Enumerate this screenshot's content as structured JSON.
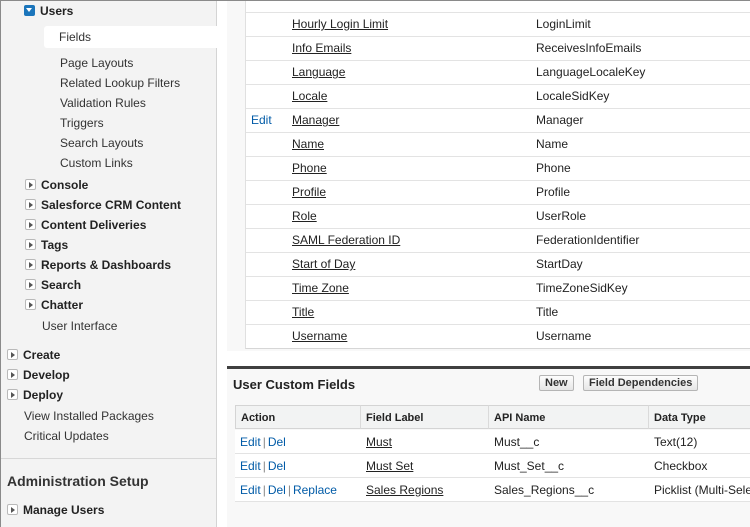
{
  "sidebar": {
    "users": "Users",
    "users_children": [
      "Fields",
      "Page Layouts",
      "Related Lookup Filters",
      "Validation Rules",
      "Triggers",
      "Search Layouts",
      "Custom Links"
    ],
    "customize_items": [
      "Console",
      "Salesforce CRM Content",
      "Content Deliveries",
      "Tags",
      "Reports & Dashboards",
      "Search",
      "Chatter"
    ],
    "user_interface": "User Interface",
    "top_items": [
      "Create",
      "Develop",
      "Deploy"
    ],
    "view_installed": "View Installed Packages",
    "critical_updates": "Critical Updates",
    "admin_setup": "Administration Setup",
    "manage_users": "Manage Users"
  },
  "standard_fields": {
    "rows": [
      {
        "edit": "",
        "label": "Hourly Login Limit",
        "api": "LoginLimit"
      },
      {
        "edit": "",
        "label": "Info Emails",
        "api": "ReceivesInfoEmails"
      },
      {
        "edit": "",
        "label": "Language",
        "api": "LanguageLocaleKey"
      },
      {
        "edit": "",
        "label": "Locale",
        "api": "LocaleSidKey"
      },
      {
        "edit": "Edit",
        "label": "Manager",
        "api": "Manager"
      },
      {
        "edit": "",
        "label": "Name",
        "api": "Name"
      },
      {
        "edit": "",
        "label": "Phone",
        "api": "Phone"
      },
      {
        "edit": "",
        "label": "Profile",
        "api": "Profile"
      },
      {
        "edit": "",
        "label": "Role",
        "api": "UserRole"
      },
      {
        "edit": "",
        "label": "SAML Federation ID",
        "api": "FederationIdentifier"
      },
      {
        "edit": "",
        "label": "Start of Day",
        "api": "StartDay"
      },
      {
        "edit": "",
        "label": "Time Zone",
        "api": "TimeZoneSidKey"
      },
      {
        "edit": "",
        "label": "Title",
        "api": "Title"
      },
      {
        "edit": "",
        "label": "Username",
        "api": "Username"
      }
    ]
  },
  "custom_fields": {
    "title": "User Custom Fields",
    "new_button": "New",
    "field_dependencies_button": "Field Dependencies",
    "headers": {
      "action": "Action",
      "label": "Field Label",
      "api": "API Name",
      "type": "Data Type"
    },
    "edit": "Edit",
    "del": "Del",
    "replace": "Replace",
    "rows": [
      {
        "label": "Must",
        "api": "Must__c",
        "type": "Text(12)"
      },
      {
        "label": "Must Set",
        "api": "Must_Set__c",
        "type": "Checkbox"
      },
      {
        "label": "Sales Regions",
        "api": "Sales_Regions__c",
        "type": "Picklist (Multi-Sele"
      }
    ]
  },
  "colors": {
    "link": "#015ba7",
    "tree_open": "#1b75bb",
    "section_rule": "#3f3f3f"
  }
}
